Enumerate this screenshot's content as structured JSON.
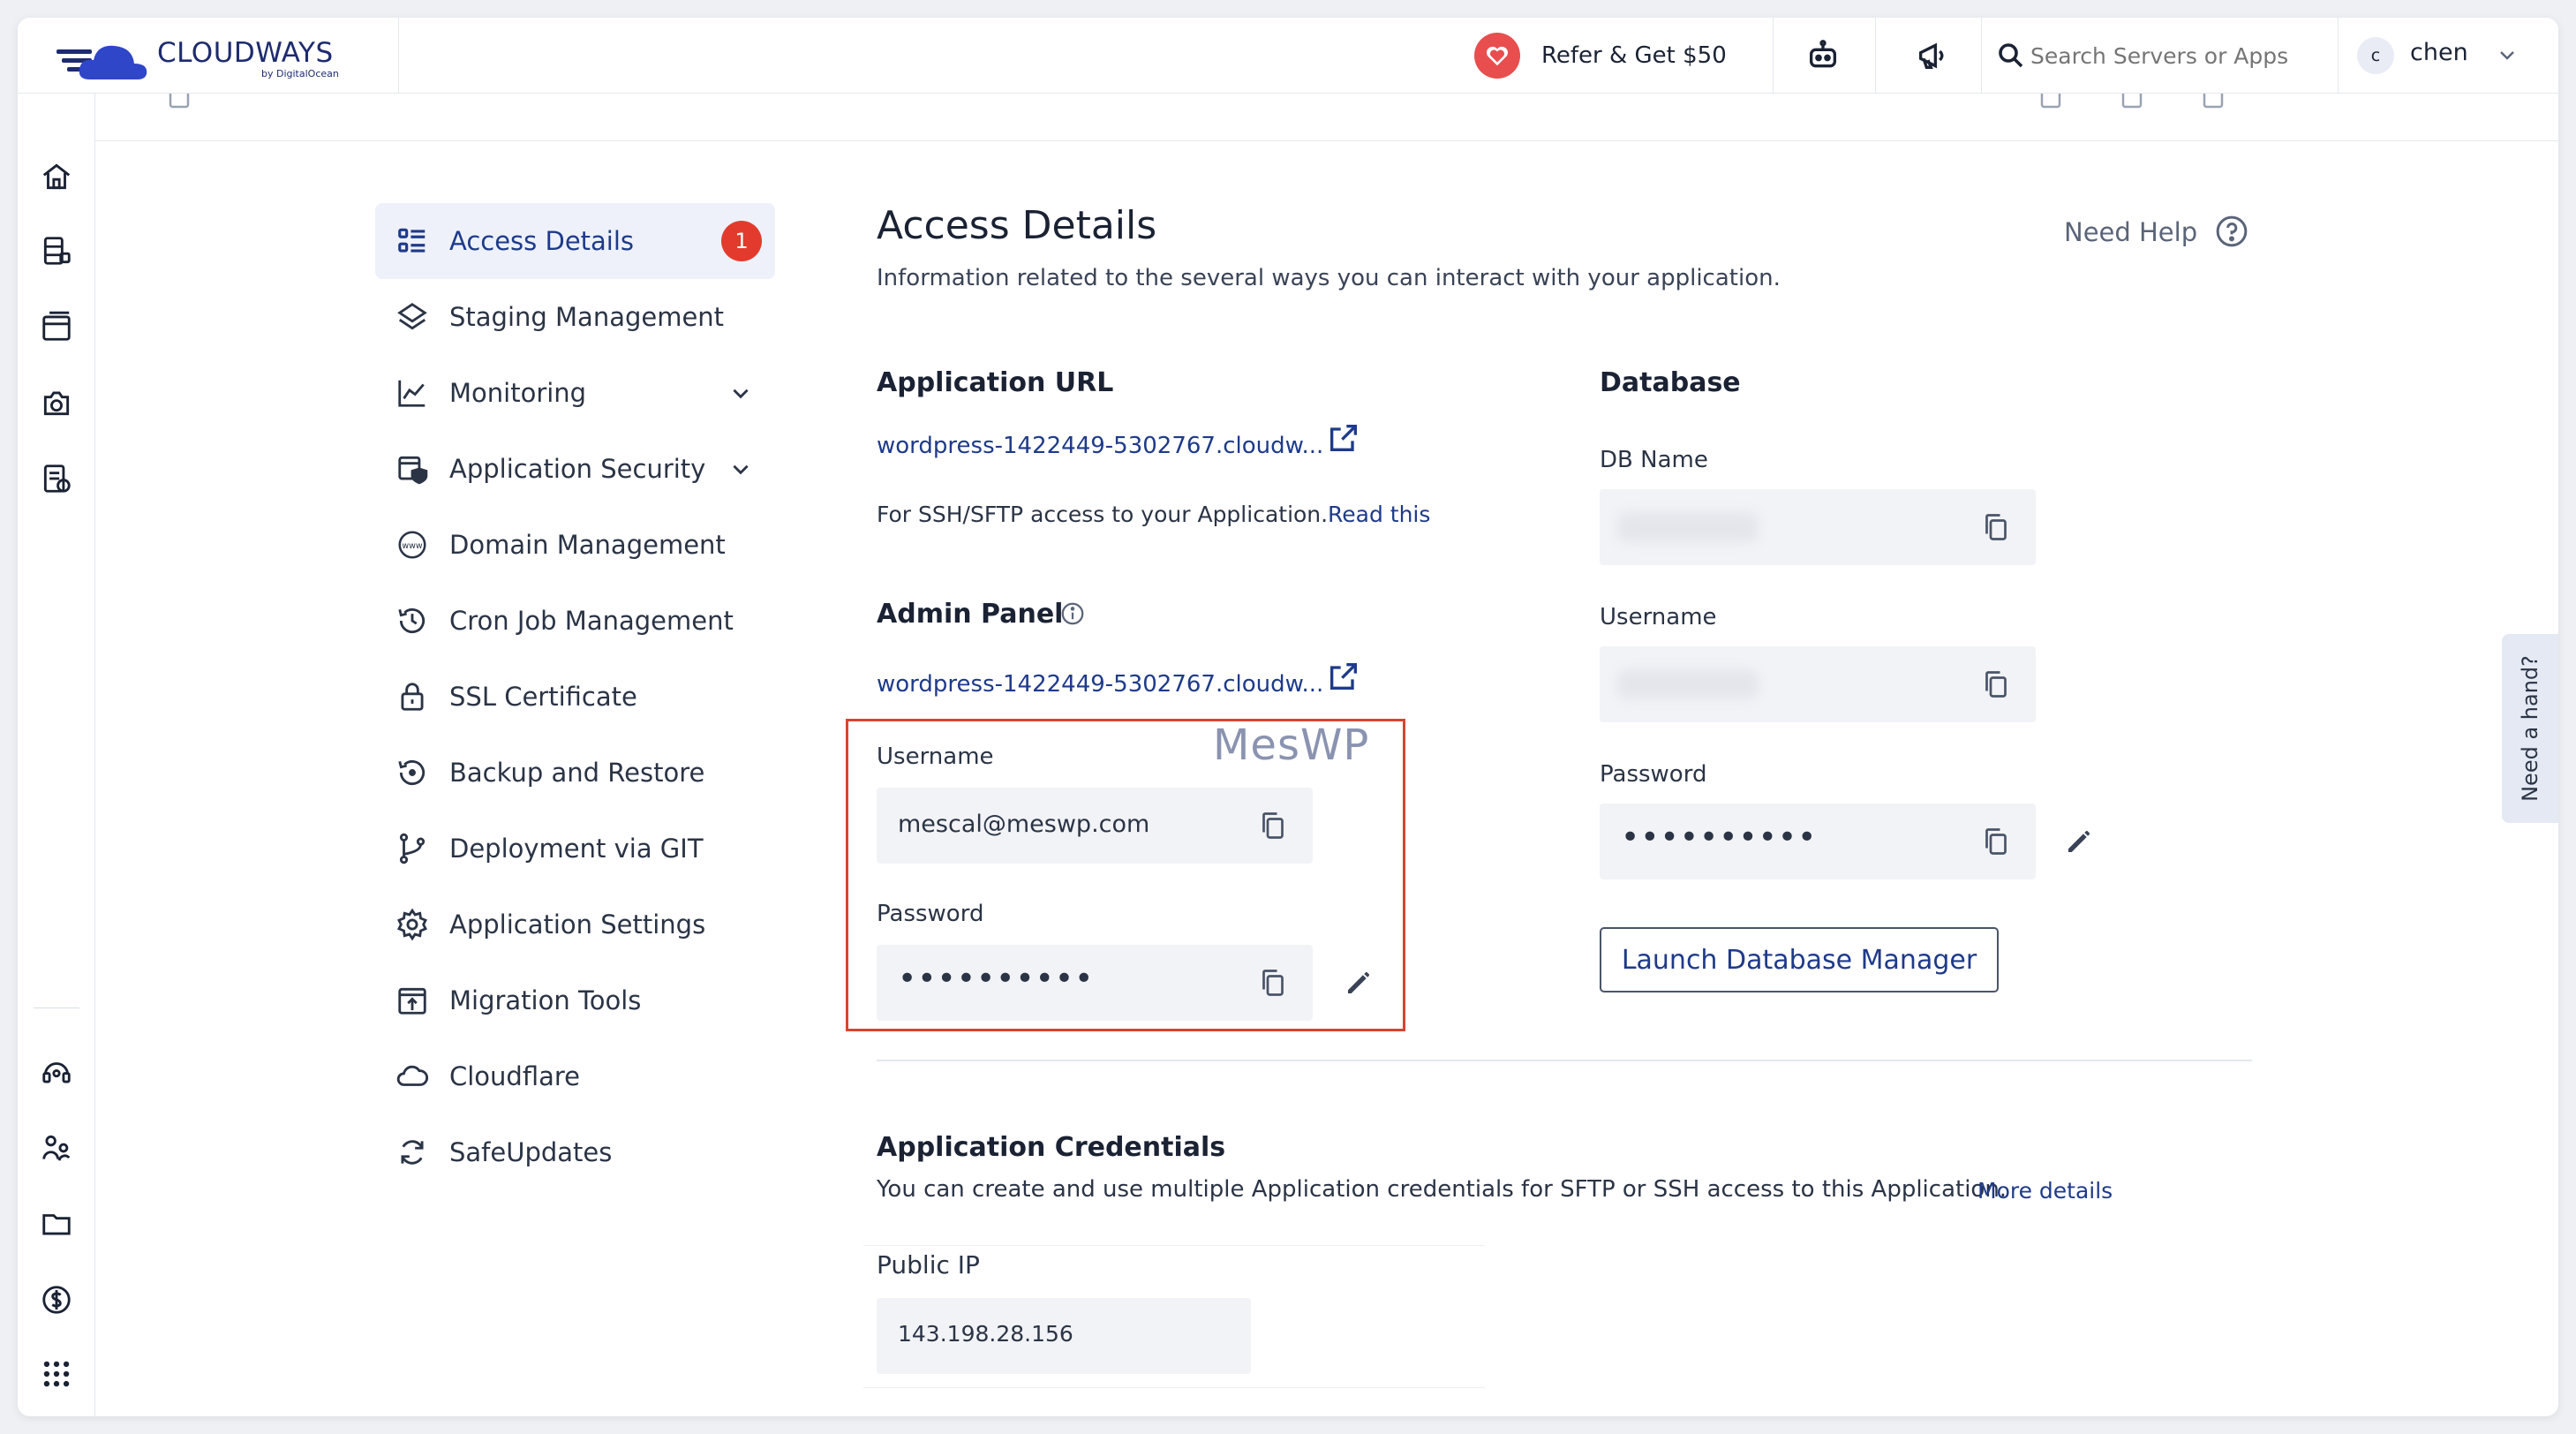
{
  "header": {
    "logo_text": "CLOUDWAYS",
    "logo_sub": "by DigitalOcean",
    "refer_label": "Refer & Get $50",
    "search_placeholder": "Search Servers or Apps",
    "user_initial": "c",
    "user_name": "chen"
  },
  "sidebar": {
    "items": [
      {
        "label": "Access Details",
        "badge": "1"
      },
      {
        "label": "Staging Management"
      },
      {
        "label": "Monitoring"
      },
      {
        "label": "Application Security"
      },
      {
        "label": "Domain Management"
      },
      {
        "label": "Cron Job Management"
      },
      {
        "label": "SSL Certificate"
      },
      {
        "label": "Backup and Restore"
      },
      {
        "label": "Deployment via GIT"
      },
      {
        "label": "Application Settings"
      },
      {
        "label": "Migration Tools"
      },
      {
        "label": "Cloudflare"
      },
      {
        "label": "SafeUpdates"
      }
    ]
  },
  "main": {
    "title": "Access Details",
    "description": "Information related to the several ways you can interact with your application.",
    "need_help": "Need Help",
    "app_url": {
      "heading": "Application URL",
      "url": "wordpress-1422449-5302767.cloudw...",
      "ssh_text": "For SSH/SFTP access to your Application.",
      "read_this": "Read this"
    },
    "admin_panel": {
      "heading": "Admin Panel",
      "url": "wordpress-1422449-5302767.cloudw...",
      "username_label": "Username",
      "username_value": "mescal@meswp.com",
      "password_label": "Password",
      "password_value": "••••••••••"
    },
    "database": {
      "heading": "Database",
      "db_name_label": "DB Name",
      "username_label": "Username",
      "password_label": "Password",
      "password_value": "••••••••••",
      "launch_button": "Launch Database Manager"
    },
    "credentials": {
      "heading": "Application Credentials",
      "description": "You can create and use multiple Application credentials for SFTP or SSH access to this Application.",
      "more_details": "More details",
      "public_ip_label": "Public IP",
      "public_ip_value": "143.198.28.156"
    },
    "watermark": "MesWP",
    "need_hand": "Need a hand?"
  },
  "colors": {
    "accent": "#1e3a8a",
    "badge": "#e23b2e",
    "highlight": "#d64531"
  }
}
